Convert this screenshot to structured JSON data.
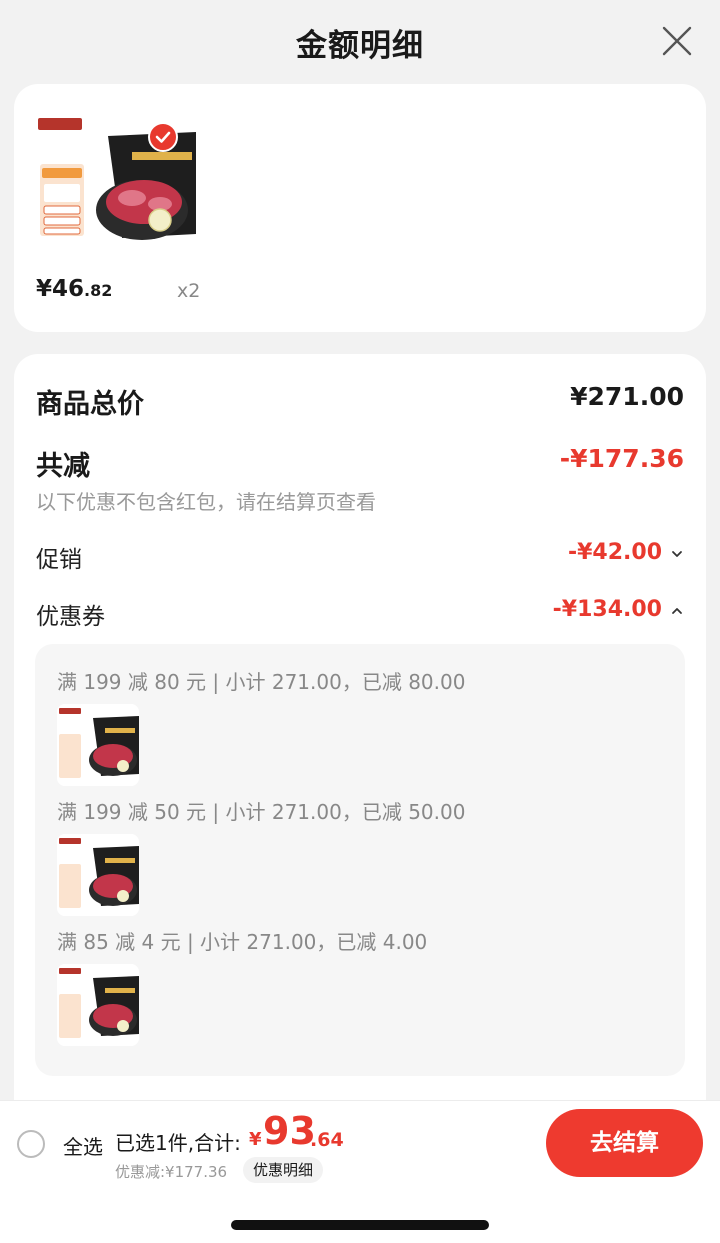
{
  "header": {
    "title": "金额明细"
  },
  "product": {
    "price_int": "¥46",
    "price_dec": ".82",
    "quantity": "x2"
  },
  "detail": {
    "total_label": "商品总价",
    "total_value": "¥271.00",
    "discount_label": "共减",
    "discount_value": "-¥177.36",
    "note": "以下优惠不包含红包，请在结算页查看",
    "promo_label": "促销",
    "promo_value": "-¥42.00",
    "coupon_label": "优惠券",
    "coupon_value": "-¥134.00",
    "coupons": [
      {
        "text": "满 199 减 80 元 | 小计 271.00，已减 80.00"
      },
      {
        "text": "满 199 减 50 元 | 小计 271.00，已减 50.00"
      },
      {
        "text": "满 85 减 4 元 | 小计 271.00，已减 4.00"
      }
    ]
  },
  "bottom": {
    "select_all": "全选",
    "selected_text": "已选1件,合计:",
    "total_cur": "¥",
    "total_int": "93",
    "total_dec": ".64",
    "saved": "优惠减:¥177.36",
    "detail_chip": "优惠明细",
    "checkout": "去结算"
  },
  "colors": {
    "accent": "#e8392e",
    "checkout": "#ee3a2f"
  }
}
